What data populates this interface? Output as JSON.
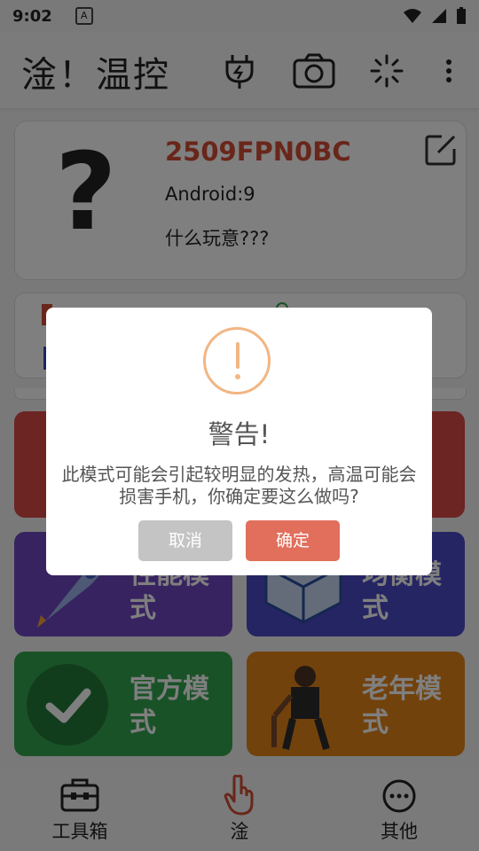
{
  "status": {
    "time": "9:02",
    "a_icon": "A"
  },
  "appbar": {
    "title": "淦！温控",
    "icons": [
      "plug-icon",
      "camera-icon",
      "loading-icon",
      "more-icon"
    ]
  },
  "device": {
    "model": "2509FPN0BC",
    "android": "Android:9",
    "desc": "什么玩意???"
  },
  "tiles": {
    "purple_label": "性能模式",
    "blue_label": "均衡模式",
    "green_label": "官方模式",
    "orange_label": "老年模式"
  },
  "nav": {
    "toolbox": "工具箱",
    "main": "淦",
    "other": "其他"
  },
  "dialog": {
    "title": "警告!",
    "message": "此模式可能会引起较明显的发热，高温可能会损害手机，你确定要这么做吗?",
    "cancel": "取消",
    "ok": "确定"
  },
  "colors": {
    "accent": "#d24d34",
    "ok_button": "#e16f5c",
    "warning": "#f2b683"
  }
}
